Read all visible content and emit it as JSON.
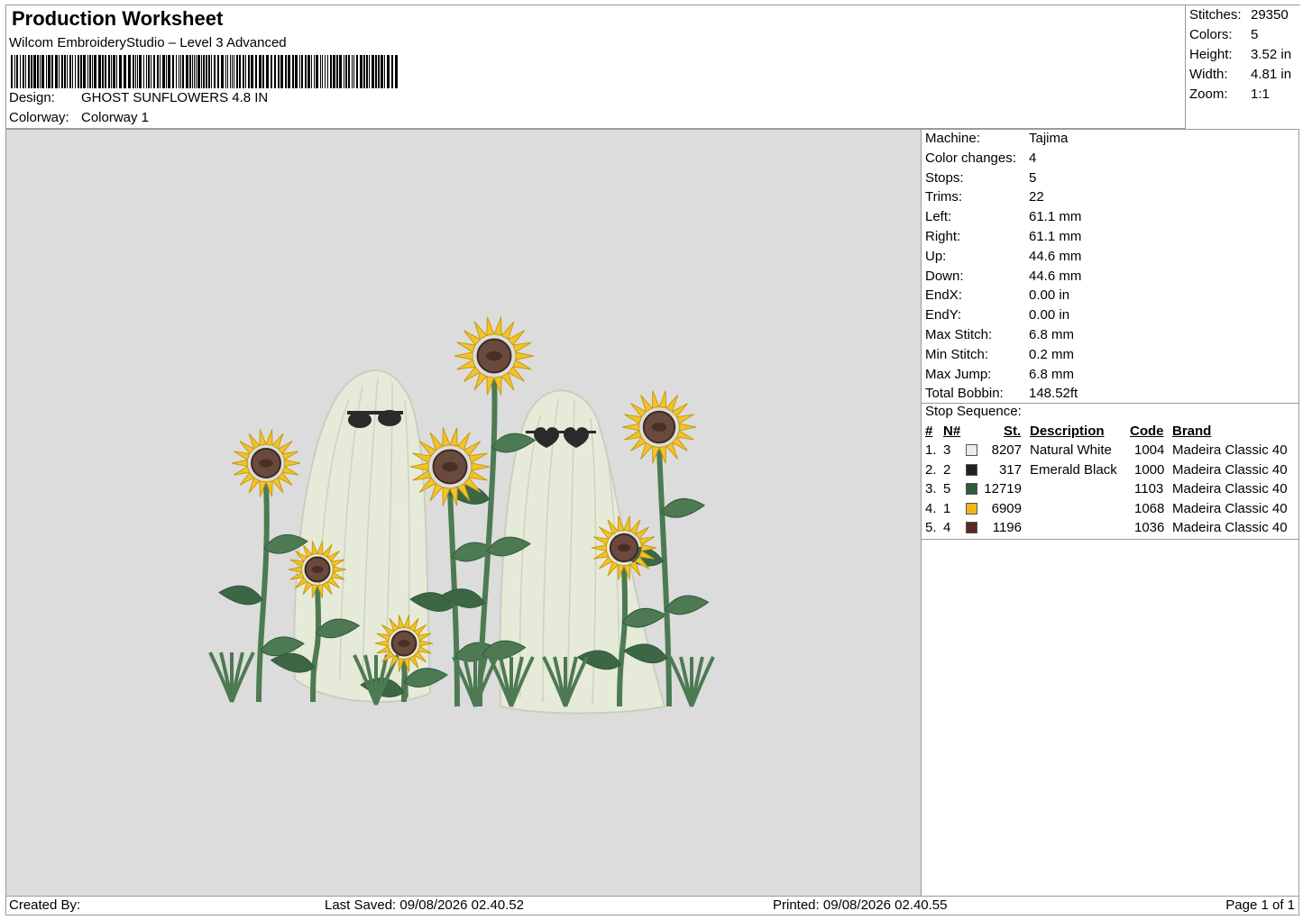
{
  "header": {
    "title": "Production Worksheet",
    "software": "Wilcom EmbroideryStudio – Level 3 Advanced",
    "design_label": "Design:",
    "design_value": "GHOST SUNFLOWERS 4.8 IN",
    "colorway_label": "Colorway:",
    "colorway_value": "Colorway 1"
  },
  "summary": {
    "stitches_label": "Stitches:",
    "stitches": "29350",
    "colors_label": "Colors:",
    "colors": "5",
    "height_label": "Height:",
    "height": "3.52 in",
    "width_label": "Width:",
    "width": "4.81 in",
    "zoom_label": "Zoom:",
    "zoom": "1:1"
  },
  "machine_info": [
    {
      "label": "Machine:",
      "value": "Tajima"
    },
    {
      "label": "Color changes:",
      "value": "4"
    },
    {
      "label": "Stops:",
      "value": "5"
    },
    {
      "label": "Trims:",
      "value": "22"
    },
    {
      "label": "Left:",
      "value": "61.1 mm"
    },
    {
      "label": "Right:",
      "value": "61.1 mm"
    },
    {
      "label": "Up:",
      "value": "44.6 mm"
    },
    {
      "label": "Down:",
      "value": "44.6 mm"
    },
    {
      "label": "EndX:",
      "value": "0.00 in"
    },
    {
      "label": "EndY:",
      "value": "0.00 in"
    },
    {
      "label": "Max Stitch:",
      "value": "6.8 mm"
    },
    {
      "label": "Min Stitch:",
      "value": "0.2 mm"
    },
    {
      "label": "Max Jump:",
      "value": "6.8 mm"
    },
    {
      "label": "Total Bobbin:",
      "value": "148.52ft"
    }
  ],
  "stop_sequence": {
    "title": "Stop Sequence:",
    "headers": {
      "num": "#",
      "n": "N#",
      "st": "St.",
      "desc": "Description",
      "code": "Code",
      "brand": "Brand"
    },
    "rows": [
      {
        "num": "1.",
        "n": "3",
        "color": "#ebebf0",
        "st": "8207",
        "desc": "Natural White",
        "code": "1004",
        "brand": "Madeira Classic 40"
      },
      {
        "num": "2.",
        "n": "2",
        "color": "#222222",
        "st": "317",
        "desc": "Emerald Black",
        "code": "1000",
        "brand": "Madeira Classic 40"
      },
      {
        "num": "3.",
        "n": "5",
        "color": "#2f5a3c",
        "st": "12719",
        "desc": "",
        "code": "1103",
        "brand": "Madeira Classic 40"
      },
      {
        "num": "4.",
        "n": "1",
        "color": "#f2b51a",
        "st": "6909",
        "desc": "",
        "code": "1068",
        "brand": "Madeira Classic 40"
      },
      {
        "num": "5.",
        "n": "4",
        "color": "#5a2a2a",
        "st": "1196",
        "desc": "",
        "code": "1036",
        "brand": "Madeira Classic 40"
      }
    ]
  },
  "footer": {
    "created_by": "Created By:",
    "last_saved": "Last Saved: 09/08/2026 02.40.52",
    "printed": "Printed: 09/08/2026 02.40.55",
    "page": "Page 1 of 1"
  },
  "colors": {
    "background": "#dcdcdc",
    "ghost": "#e6ead9",
    "leaf": "#4d7a52",
    "petal": "#f0c42a",
    "center": "#6a4a3c"
  }
}
